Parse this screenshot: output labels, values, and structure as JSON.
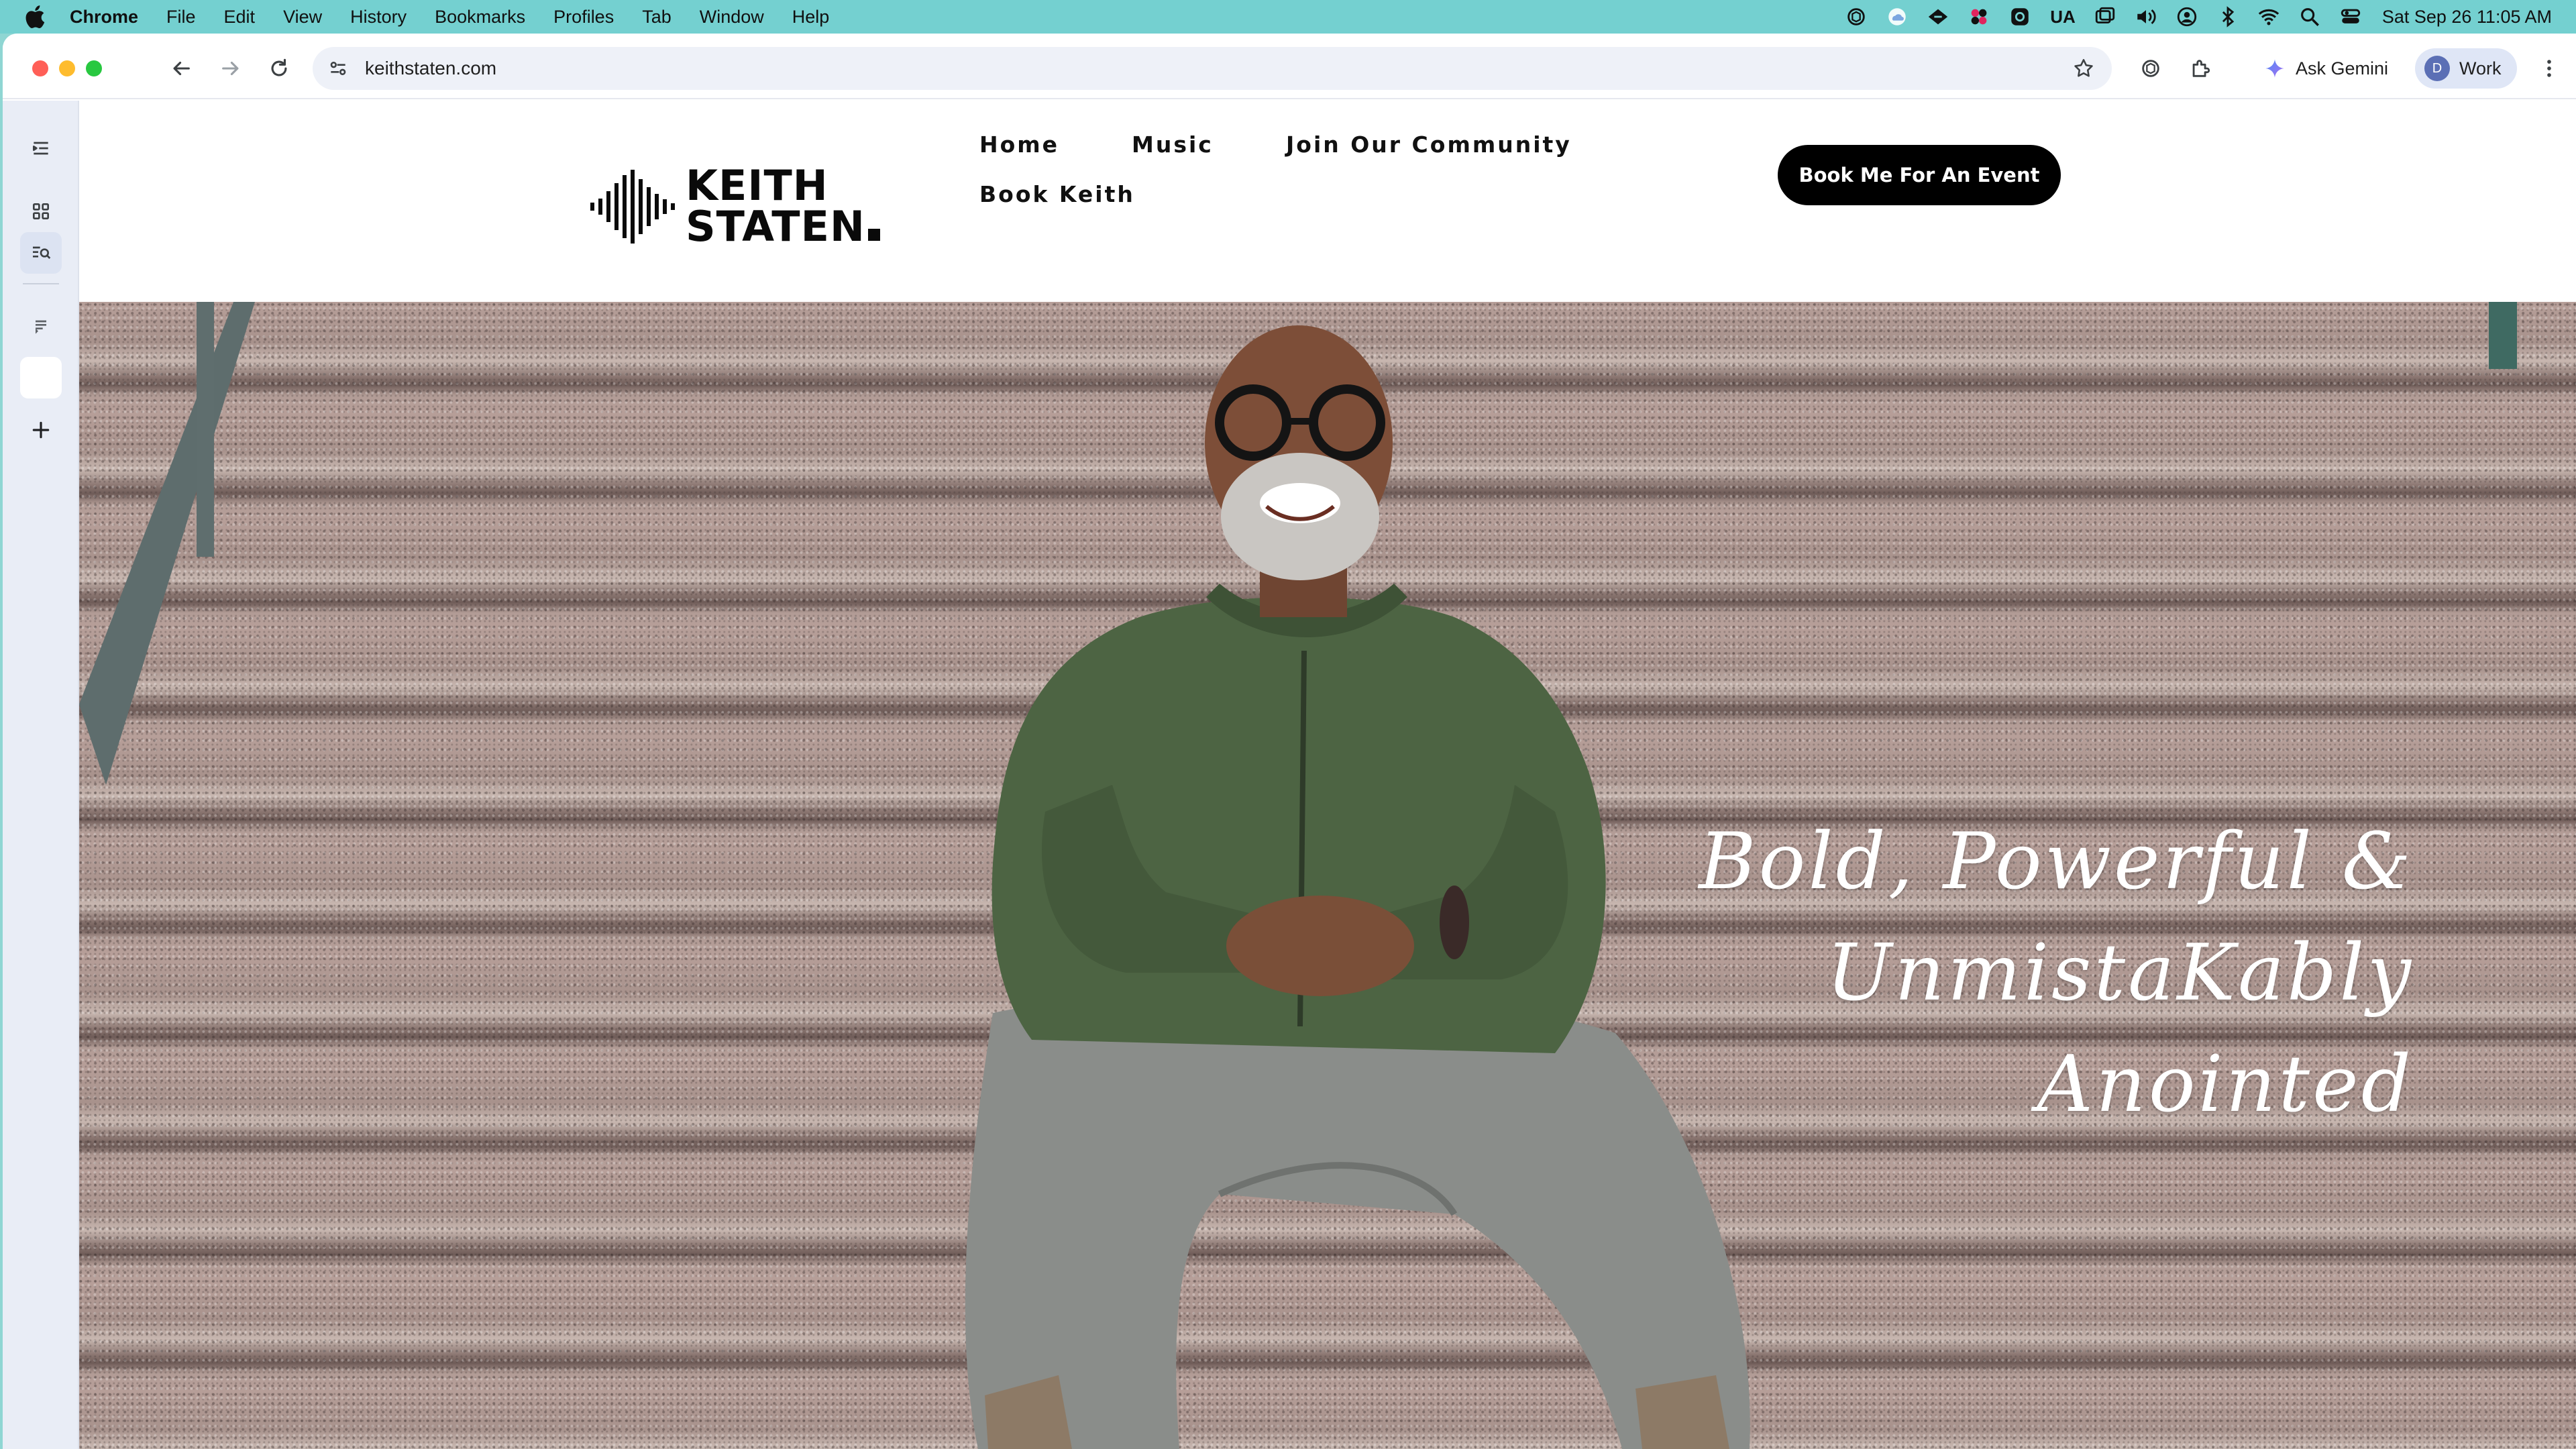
{
  "menubar": {
    "app_name": "Chrome",
    "items": [
      "File",
      "Edit",
      "View",
      "History",
      "Bookmarks",
      "Profiles",
      "Tab",
      "Window",
      "Help"
    ],
    "status_icons": [
      "chatgpt-icon",
      "cloud-icon",
      "vpn-icon",
      "butterfly-icon",
      "app-icon",
      "ua-badge",
      "window-icon",
      "volume-icon",
      "user-circle-icon",
      "bluetooth-icon",
      "wifi-icon",
      "spotlight-icon",
      "control-center-icon"
    ],
    "ua_label": "UA",
    "clock": "Sat Sep 26  11:05 AM"
  },
  "browser": {
    "url": "keithstaten.com",
    "gemini_label": "Ask Gemini",
    "profile_initial": "D",
    "profile_label": "Work"
  },
  "site": {
    "logo": {
      "line1": "KEITH",
      "line2": "STATEN"
    },
    "nav": [
      {
        "label": "Home"
      },
      {
        "label": "Music"
      },
      {
        "label": "Join Our Community"
      },
      {
        "label": "Book Keith"
      }
    ],
    "cta_label": "Book Me For An Event",
    "hero": {
      "line1": "Bold, Powerful &",
      "line2": "UnmistaKably",
      "line3": "Anointed"
    }
  },
  "colors": {
    "menubar_bg": "#74d0d0",
    "cta_bg": "#000000",
    "jacket": "#4d6443",
    "pants": "#8a8d8a"
  }
}
